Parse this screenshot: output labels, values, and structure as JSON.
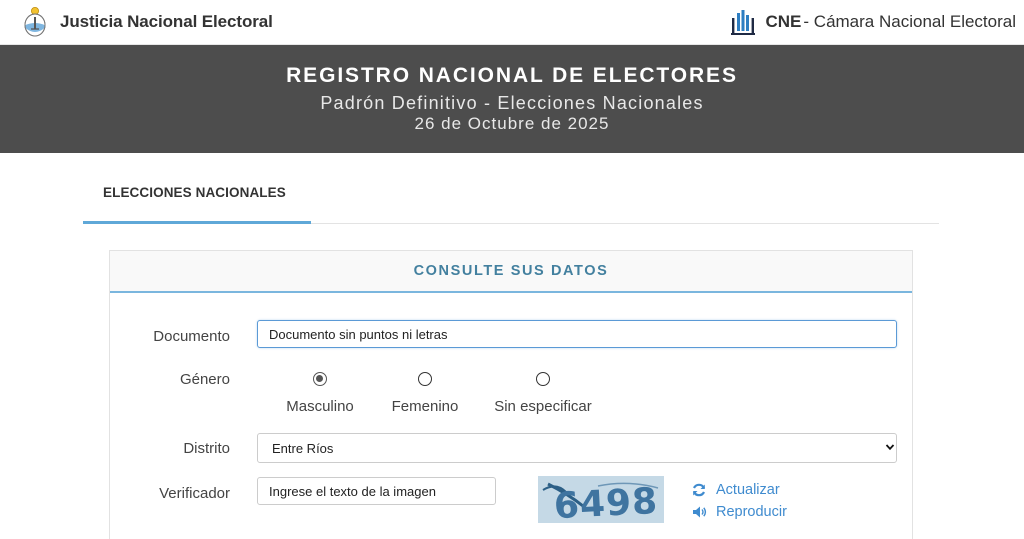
{
  "header": {
    "left_brand": "Justicia Nacional Electoral",
    "right_brand_strong": "CNE",
    "right_brand_rest": "- Cámara Nacional Electoral"
  },
  "hero": {
    "title": "REGISTRO NACIONAL DE ELECTORES",
    "subtitle": "Padrón Definitivo - Elecciones Nacionales",
    "date": "26 de Octubre de 2025"
  },
  "tabs": [
    {
      "label": "ELECCIONES NACIONALES",
      "active": true
    }
  ],
  "form": {
    "title": "CONSULTE SUS DATOS",
    "documento": {
      "label": "Documento",
      "value": "",
      "placeholder": "Documento sin puntos ni letras"
    },
    "genero": {
      "label": "Género",
      "options": [
        "Masculino",
        "Femenino",
        "Sin especificar"
      ],
      "selected": "Masculino"
    },
    "distrito": {
      "label": "Distrito",
      "selected": "Entre Ríos"
    },
    "verificador": {
      "label": "Verificador",
      "value": "",
      "placeholder": "Ingrese el texto de la imagen",
      "captcha_text": "6498"
    },
    "actions": {
      "refresh": "Actualizar",
      "play": "Reproducir"
    }
  },
  "colors": {
    "hero_bg": "#4d4d4d",
    "accent": "#5fa8d8",
    "panel_title": "#43809f",
    "link": "#3f8bcf"
  },
  "icons": {
    "left_logo": "argentina-seal-icon",
    "right_logo": "cne-logo-icon",
    "refresh": "refresh-icon",
    "play": "speaker-icon"
  }
}
